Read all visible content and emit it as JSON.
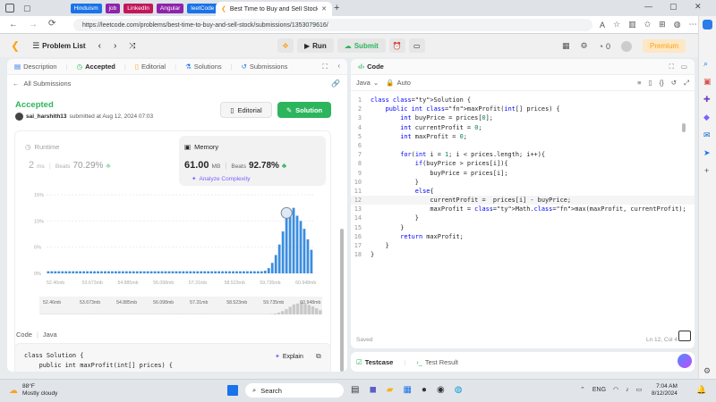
{
  "browser": {
    "bookmarks": [
      {
        "label": "Hinduism",
        "color": "#1a73e8"
      },
      {
        "label": "job",
        "color": "#8e24aa"
      },
      {
        "label": "LinkedIn",
        "color": "#c2185b"
      },
      {
        "label": "Angular",
        "color": "#8e24aa"
      },
      {
        "label": "leetCode",
        "color": "#1a73e8"
      }
    ],
    "tab_title": "Best Time to Buy and Sell Stock",
    "url": "https://leetcode.com/problems/best-time-to-buy-and-sell-stock/submissions/1353079616/"
  },
  "header": {
    "problem_list": "Problem List",
    "run": "Run",
    "submit": "Submit",
    "coins": "0",
    "premium": "Premium"
  },
  "left": {
    "tabs": [
      "Description",
      "Accepted",
      "Editorial",
      "Solutions",
      "Submissions"
    ],
    "all_submissions": "All Submissions",
    "status": "Accepted",
    "user": "sai_harshith13",
    "submitted_text": "submitted at Aug 12, 2024 07:03",
    "editorial_btn": "Editorial",
    "solution_btn": "Solution",
    "runtime": {
      "label": "Runtime",
      "value": "2",
      "unit": "ms",
      "beats_label": "Beats",
      "beats": "70.29%"
    },
    "memory": {
      "label": "Memory",
      "value": "61.00",
      "unit": "MB",
      "beats_label": "Beats",
      "beats": "92.78%"
    },
    "analyze": "Analyze Complexity",
    "code_header": [
      "Code",
      "Java"
    ],
    "explain": "Explain",
    "code_preview": [
      "class Solution {",
      "    public int maxProfit(int[] prices) {"
    ]
  },
  "chart_data": {
    "type": "bar",
    "ylim": [
      0,
      15
    ],
    "yticks": [
      "15%",
      "10%",
      "5%",
      "0%"
    ],
    "xticks": [
      "52.46mb",
      "53.673mb",
      "54.885mb",
      "56.098mb",
      "57.31mb",
      "58.523mb",
      "59.735mb",
      "60.948mb"
    ],
    "values": [
      0.4,
      0.4,
      0.4,
      0.4,
      0.4,
      0.4,
      0.4,
      0.4,
      0.4,
      0.4,
      0.4,
      0.4,
      0.4,
      0.4,
      0.4,
      0.4,
      0.4,
      0.4,
      0.4,
      0.4,
      0.4,
      0.4,
      0.4,
      0.4,
      0.4,
      0.4,
      0.4,
      0.4,
      0.4,
      0.4,
      0.4,
      0.4,
      0.4,
      0.4,
      0.4,
      0.4,
      0.4,
      0.4,
      0.4,
      0.4,
      0.4,
      0.4,
      0.4,
      0.4,
      0.4,
      0.4,
      0.4,
      0.4,
      0.4,
      0.4,
      0.4,
      0.4,
      0.4,
      0.4,
      0.4,
      0.4,
      0.4,
      0.4,
      0.4,
      0.4,
      0.4,
      0.5,
      1.0,
      2.0,
      3.5,
      5.5,
      8.0,
      10.5,
      11.5,
      12.5,
      11.0,
      10.0,
      8.5,
      6.5,
      4.5
    ],
    "highlight_index": 67
  },
  "right": {
    "title": "Code",
    "lang": "Java",
    "auto": "Auto",
    "saved": "Saved",
    "cursor": "Ln 12, Col 4",
    "code": [
      "class Solution {",
      "    public int maxProfit(int[] prices) {",
      "        int buyPrice = prices[0];",
      "        int currentProfit = 0;",
      "        int maxProfit = 0;",
      "",
      "        for(int i = 1; i < prices.length; i++){",
      "            if(buyPrice > prices[i]){",
      "                buyPrice = prices[i];",
      "            }",
      "            else{",
      "                currentProfit =  prices[i] - buyPrice;",
      "                maxProfit = Math.max(maxProfit, currentProfit);",
      "            }",
      "        }",
      "        return maxProfit;",
      "    }",
      "}"
    ],
    "line_numbers": [
      "1",
      "2",
      "3",
      "4",
      "5",
      "6",
      "7",
      "8",
      "9",
      "10",
      "11",
      "12",
      "13",
      "14",
      "15",
      "16",
      "17",
      "18"
    ]
  },
  "bottom": {
    "testcase": "Testcase",
    "test_result": "Test Result"
  },
  "taskbar": {
    "weather_temp": "88°F",
    "weather_desc": "Mostly cloudy",
    "search": "Search",
    "lang": "ENG",
    "time": "7:04 AM",
    "date": "8/12/2024"
  }
}
